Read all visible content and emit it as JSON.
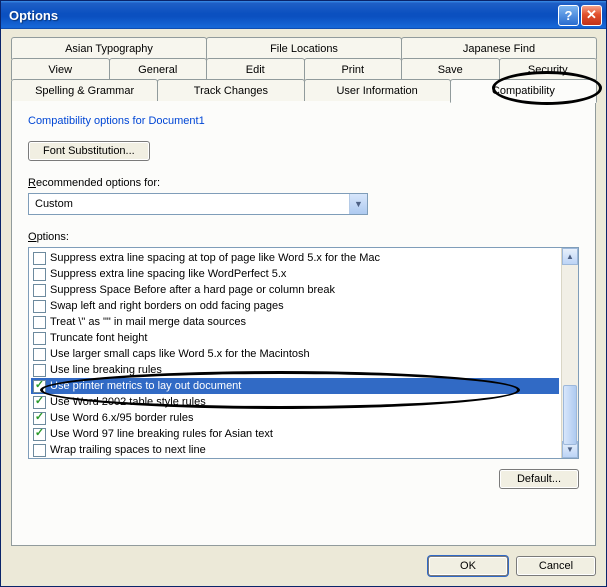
{
  "window": {
    "title": "Options",
    "help_tooltip": "Help",
    "close_tooltip": "Close"
  },
  "tabs": {
    "row1": [
      "Asian Typography",
      "File Locations",
      "Japanese Find"
    ],
    "row2": [
      "View",
      "General",
      "Edit",
      "Print",
      "Save",
      "Security"
    ],
    "row3": [
      "Spelling & Grammar",
      "Track Changes",
      "User Information",
      "Compatibility"
    ],
    "active": "Compatibility"
  },
  "panel": {
    "heading": "Compatibility options for Document1",
    "font_substitution_label": "Font Substitution...",
    "recommended_label": "Recommended options for:",
    "recommended_value": "Custom",
    "options_label": "Options:",
    "default_button": "Default..."
  },
  "options_list": [
    {
      "label": "Suppress extra line spacing at top of page like Word 5.x for the Mac",
      "checked": false,
      "selected": false
    },
    {
      "label": "Suppress extra line spacing like WordPerfect 5.x",
      "checked": false,
      "selected": false
    },
    {
      "label": "Suppress Space Before after a hard page or column break",
      "checked": false,
      "selected": false
    },
    {
      "label": "Swap left and right borders on odd facing pages",
      "checked": false,
      "selected": false
    },
    {
      "label": "Treat \\\" as \"\" in mail merge data sources",
      "checked": false,
      "selected": false
    },
    {
      "label": "Truncate font height",
      "checked": false,
      "selected": false
    },
    {
      "label": "Use larger small caps like Word 5.x for the Macintosh",
      "checked": false,
      "selected": false
    },
    {
      "label": "Use line breaking rules",
      "checked": false,
      "selected": false
    },
    {
      "label": "Use printer metrics to lay out document",
      "checked": true,
      "selected": true
    },
    {
      "label": "Use Word 2002 table style rules",
      "checked": true,
      "selected": false
    },
    {
      "label": "Use Word 6.x/95 border rules",
      "checked": true,
      "selected": false
    },
    {
      "label": "Use Word 97 line breaking rules for Asian text",
      "checked": true,
      "selected": false
    },
    {
      "label": "Wrap trailing spaces to next line",
      "checked": false,
      "selected": false
    }
  ],
  "dialog_buttons": {
    "ok": "OK",
    "cancel": "Cancel"
  }
}
